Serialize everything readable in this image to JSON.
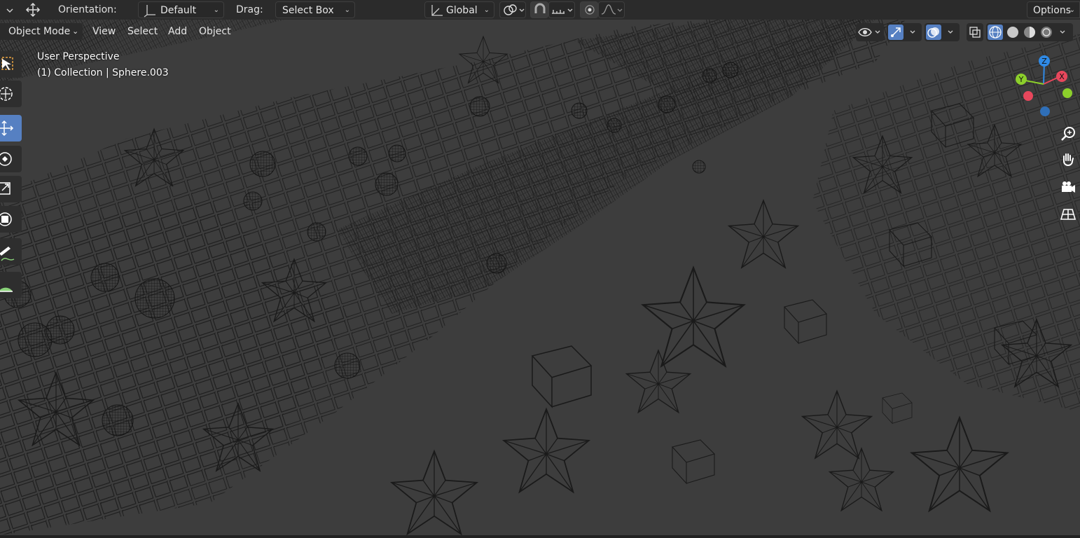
{
  "topbar": {
    "orientation_label": "Orientation:",
    "orientation_value": "Default",
    "drag_label": "Drag:",
    "drag_value": "Select Box",
    "transform_space": "Global",
    "options_label": "Options"
  },
  "header": {
    "mode": "Object Mode",
    "menu": [
      "View",
      "Select",
      "Add",
      "Object"
    ]
  },
  "viewport": {
    "perspective": "User Perspective",
    "collection_info": "(1) Collection | Sphere.003"
  },
  "gizmo": {
    "x_label": "X",
    "y_label": "Y",
    "z_label": "Z",
    "colors": {
      "x": "#e8475c",
      "y": "#8ccf2b",
      "z": "#2f8ae6"
    }
  },
  "icons": {
    "tools": [
      "select-box-icon",
      "cursor-icon",
      "move-icon",
      "rotate-icon",
      "scale-icon",
      "transform-icon",
      "annotate-icon",
      "measure-icon"
    ],
    "nav": [
      "zoom-icon",
      "pan-hand-icon",
      "camera-icon",
      "grid-icon"
    ]
  },
  "colors": {
    "accent": "#5680c2",
    "background": "#3d3d3d",
    "bar": "#2b2b2b"
  }
}
